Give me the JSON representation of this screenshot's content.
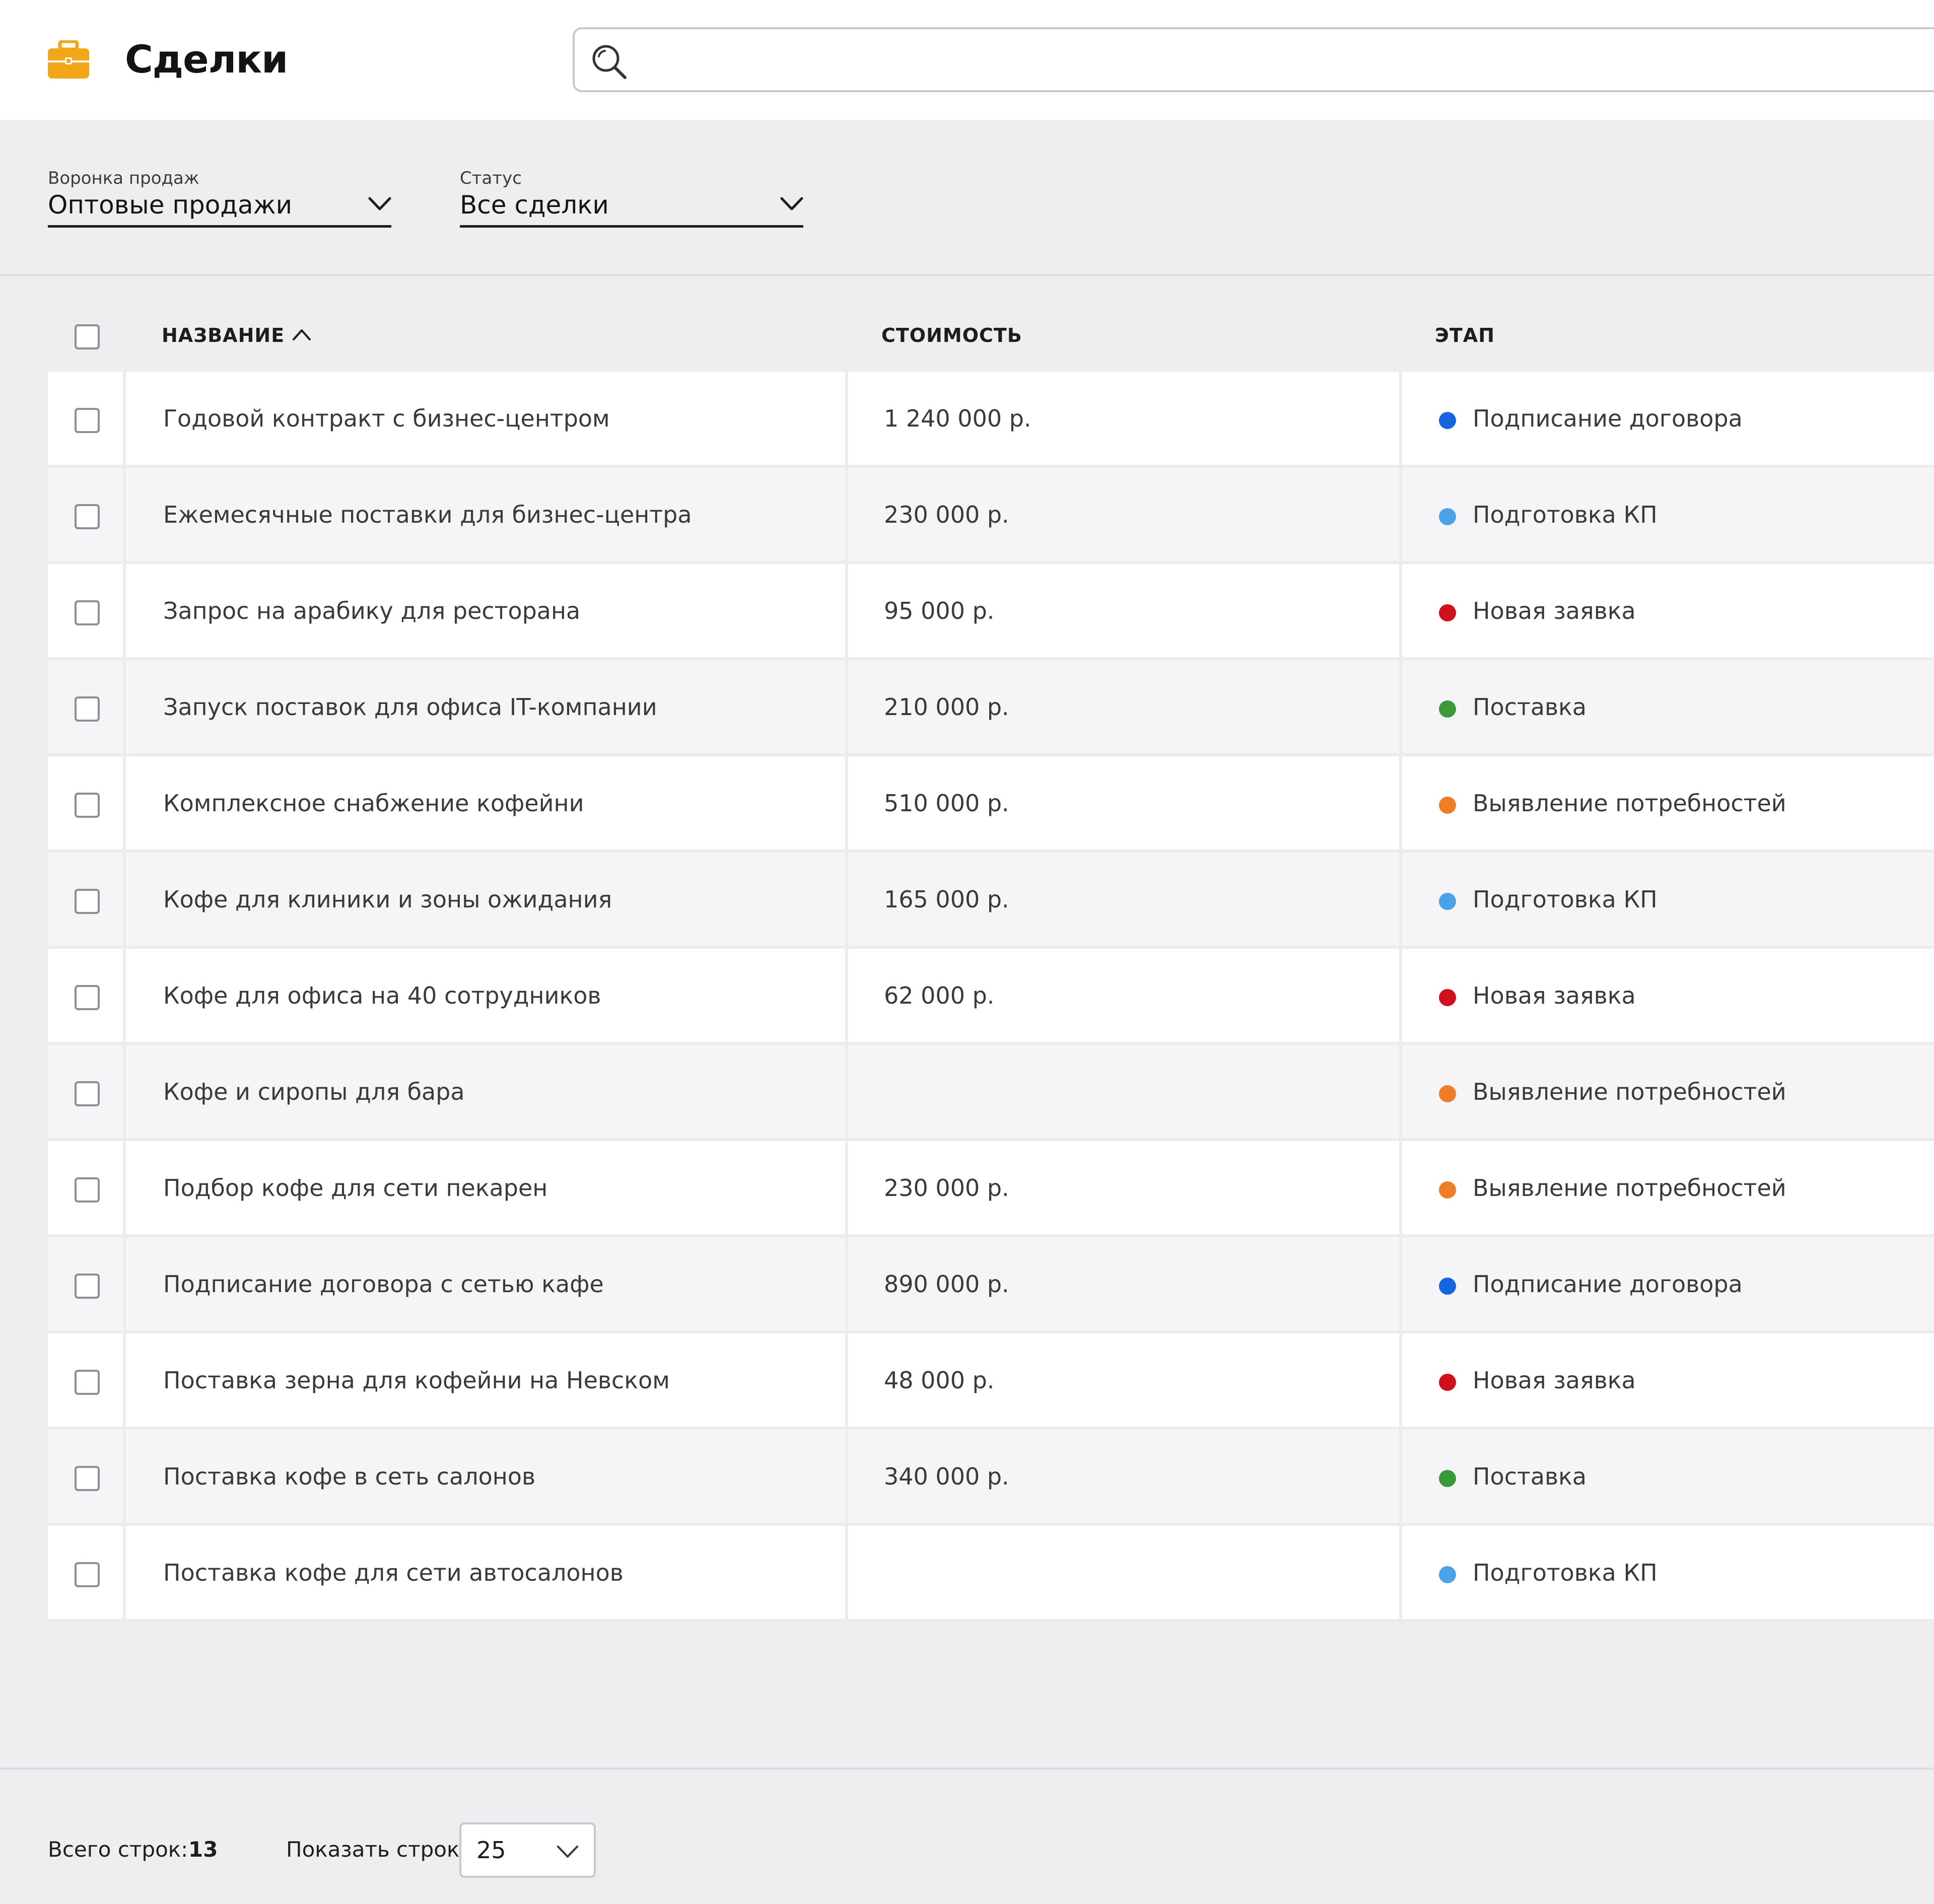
{
  "header": {
    "title": "Сделки",
    "app_icon": "briefcase-icon",
    "search_placeholder": "",
    "search_value": ""
  },
  "filters": {
    "funnel": {
      "label": "Воронка продаж",
      "value": "Оптовые продажи"
    },
    "status": {
      "label": "Статус",
      "value": "Все сделки"
    }
  },
  "table": {
    "columns": {
      "name": "НАЗВАНИЕ",
      "price": "СТОИМОСТЬ",
      "stage": "ЭТАП"
    },
    "sort": {
      "column": "name",
      "direction": "asc"
    },
    "rows": [
      {
        "name": "Годовой контракт с бизнес-центром",
        "price": "1 240 000 р.",
        "stage": "Подписание договора",
        "stage_color": "#1565e0"
      },
      {
        "name": "Ежемесячные поставки для бизнес-центра",
        "price": "230 000 р.",
        "stage": "Подготовка КП",
        "stage_color": "#4aa3ea"
      },
      {
        "name": "Запрос на арабику для ресторана",
        "price": "95 000 р.",
        "stage": "Новая заявка",
        "stage_color": "#d0101c"
      },
      {
        "name": "Запуск поставок для офиса IT-компании",
        "price": "210 000 р.",
        "stage": "Поставка",
        "stage_color": "#3a9a3a"
      },
      {
        "name": "Комплексное снабжение кофейни",
        "price": "510 000 р.",
        "stage": "Выявление потребностей",
        "stage_color": "#ef7d27"
      },
      {
        "name": "Кофе для клиники и зоны ожидания",
        "price": "165 000 р.",
        "stage": "Подготовка КП",
        "stage_color": "#4aa3ea"
      },
      {
        "name": "Кофе для офиса на 40 сотрудников",
        "price": "62 000 р.",
        "stage": "Новая заявка",
        "stage_color": "#d0101c"
      },
      {
        "name": "Кофе и сиропы для бара",
        "price": "",
        "stage": "Выявление потребностей",
        "stage_color": "#ef7d27"
      },
      {
        "name": "Подбор кофе для сети пекарен",
        "price": "230 000 р.",
        "stage": "Выявление потребностей",
        "stage_color": "#ef7d27"
      },
      {
        "name": "Подписание договора с сетью кафе",
        "price": "890 000 р.",
        "stage": "Подписание договора",
        "stage_color": "#1565e0"
      },
      {
        "name": "Поставка зерна для кофейни на Невском",
        "price": "48 000 р.",
        "stage": "Новая заявка",
        "stage_color": "#d0101c"
      },
      {
        "name": "Поставка кофе в сеть салонов",
        "price": "340 000 р.",
        "stage": "Поставка",
        "stage_color": "#3a9a3a"
      },
      {
        "name": "Поставка кофе для сети автосалонов",
        "price": "",
        "stage": "Подготовка КП",
        "stage_color": "#4aa3ea"
      }
    ]
  },
  "footer": {
    "total_label": "Всего строк:",
    "total_value": "13",
    "show_label": "Показать строк",
    "rows_per_page": "25"
  }
}
